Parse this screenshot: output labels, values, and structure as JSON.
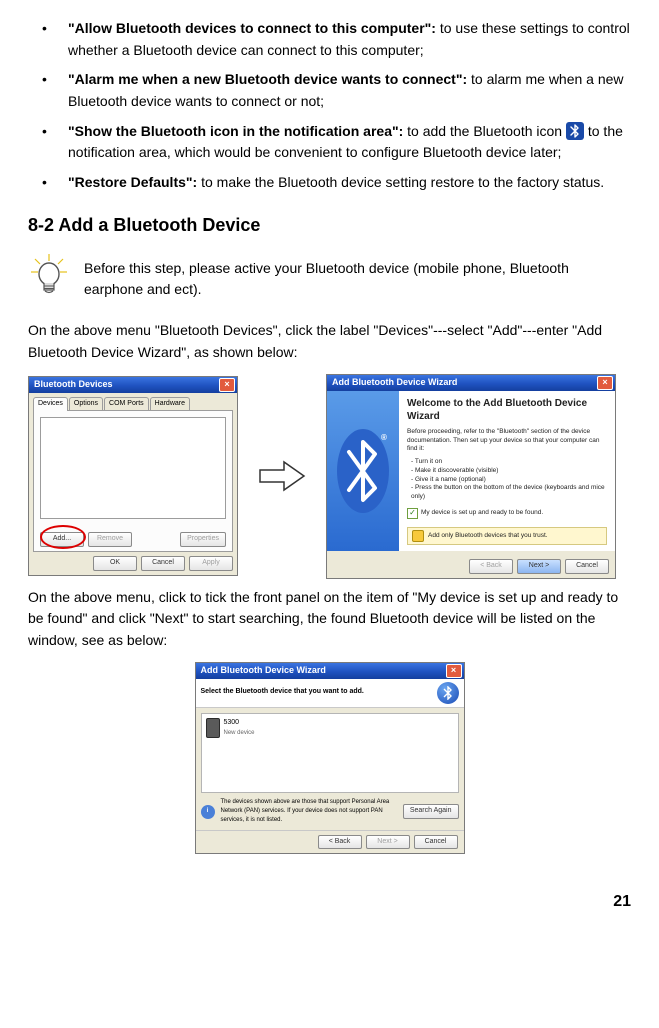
{
  "bullets": {
    "allow_title": "\"Allow Bluetooth devices to connect to this computer\":",
    "allow_text": " to use these settings to control whether a Bluetooth device can connect to this computer;",
    "alarm_title": "\"Alarm me when a new Bluetooth device wants to connect\":",
    "alarm_text": " to alarm me when a new Bluetooth device wants to connect or not;",
    "show_title": "\"Show the Bluetooth icon in the notification area\":",
    "show_text_a": " to add the Bluetooth icon ",
    "show_text_b": " to the notification area, which would be convenient to configure Bluetooth device later;",
    "restore_title": " \"Restore Defaults\":",
    "restore_text": " to make the Bluetooth device setting restore to the factory status."
  },
  "section_heading": "8-2 Add a Bluetooth Device",
  "tip_text": "Before this step, please active your Bluetooth device (mobile phone, Bluetooth earphone and ect).",
  "para1": "On the above menu \"Bluetooth Devices\", click the label \"Devices\"---select \"Add\"---enter \"Add Bluetooth Device Wizard\", as shown below:",
  "para2": "On the above menu, click to tick the front panel on the item of \"My device is set up and ready to be found\" and click \"Next\" to start searching, the found Bluetooth device will be listed on the window, see as below:",
  "page_number": "21",
  "dlg1": {
    "title": "Bluetooth Devices",
    "tabs": {
      "devices": "Devices",
      "options": "Options",
      "com": "COM Ports",
      "hardware": "Hardware"
    },
    "add": "Add...",
    "remove": "Remove",
    "properties": "Properties",
    "ok": "OK",
    "cancel": "Cancel",
    "apply": "Apply"
  },
  "dlg2": {
    "title": "Add Bluetooth Device Wizard",
    "welcome": "Welcome to the Add Bluetooth Device Wizard",
    "intro": "Before proceeding, refer to the \"Bluetooth\" section of the device documentation. Then set up your device so that your computer can find it:",
    "li1": "- Turn it on",
    "li2": "- Make it discoverable (visible)",
    "li3": "- Give it a name (optional)",
    "li4": "- Press the button on the bottom of the device (keyboards and mice only)",
    "check": "My device is set up and ready to be found.",
    "secnote": "Add only Bluetooth devices that you trust.",
    "back": "< Back",
    "next": "Next >",
    "cancel": "Cancel"
  },
  "dlg3": {
    "title": "Add Bluetooth Device Wizard",
    "header": "Select the Bluetooth device that you want to add.",
    "device_name": "5300",
    "device_kind": "New device",
    "note": "The devices shown above are those that support Personal Area Network (PAN) services. If your device does not support PAN services, it is not listed.",
    "search": "Search Again",
    "back": "< Back",
    "next": "Next >",
    "cancel": "Cancel"
  }
}
